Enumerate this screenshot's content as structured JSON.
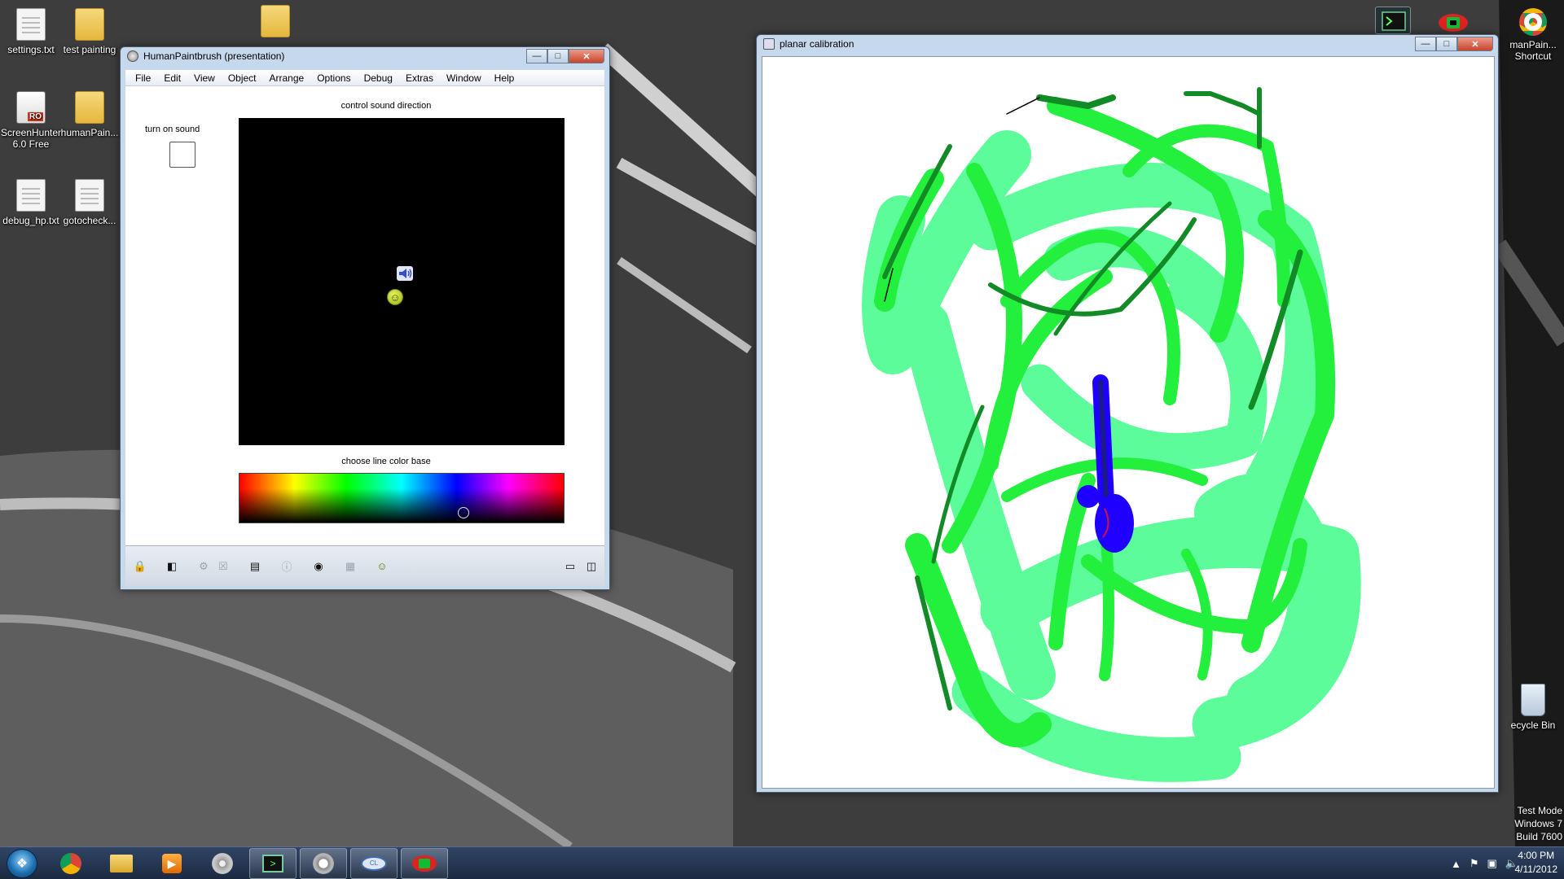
{
  "desktop_icons": [
    {
      "label": "settings.txt",
      "kind": "text-file-icon"
    },
    {
      "label": "test painting",
      "kind": "folder-icon"
    },
    {
      "label": "ScreenHunter 6.0 Free",
      "kind": "screenhunter-icon"
    },
    {
      "label": "humanPain...",
      "kind": "folder-icon"
    },
    {
      "label": "debug_hp.txt",
      "kind": "text-file-icon"
    },
    {
      "label": "gotocheck...",
      "kind": "text-file-icon"
    },
    {
      "label": "manPain... Shortcut",
      "kind": "chrome-icon"
    },
    {
      "label": "ecycle Bin",
      "kind": "recycle-bin-icon"
    }
  ],
  "hp_window": {
    "title": "HumanPaintbrush (presentation)",
    "menu": [
      "File",
      "Edit",
      "View",
      "Object",
      "Arrange",
      "Options",
      "Debug",
      "Extras",
      "Window",
      "Help"
    ],
    "sound_label": "turn on sound",
    "sound_enabled": false,
    "direction_label": "control sound direction",
    "color_label": "choose line color base",
    "color_handle_hue_fraction": 0.69,
    "toolbar_icons": [
      "lock-icon",
      "layers-icon",
      "tools-icon",
      "close-small-icon",
      "chart-icon",
      "info-icon",
      "slider-icon",
      "grid-icon",
      "smiley-icon",
      "layout-single-icon",
      "layout-split-icon"
    ]
  },
  "pc_window": {
    "title": "planar calibration",
    "stroke_colors": [
      "#5dfc9a",
      "#22f03c",
      "#128a26",
      "#1f00ff"
    ]
  },
  "desktop_info": {
    "line1": "Test Mode",
    "line2": "Windows 7",
    "line3": "Build 7600"
  },
  "taskbar": {
    "apps": [
      "chrome-icon",
      "explorer-icon",
      "media-player-icon",
      "disc-icon",
      "terminal-icon",
      "chrome-dev-icon",
      "opencl-icon",
      "eye-app-icon"
    ],
    "time": "4:00 PM",
    "date": "4/11/2012"
  },
  "colors": {
    "taskbar": "#1c2a40",
    "window_frame": "#c6d8ec",
    "accent_green": "#22f03c"
  }
}
